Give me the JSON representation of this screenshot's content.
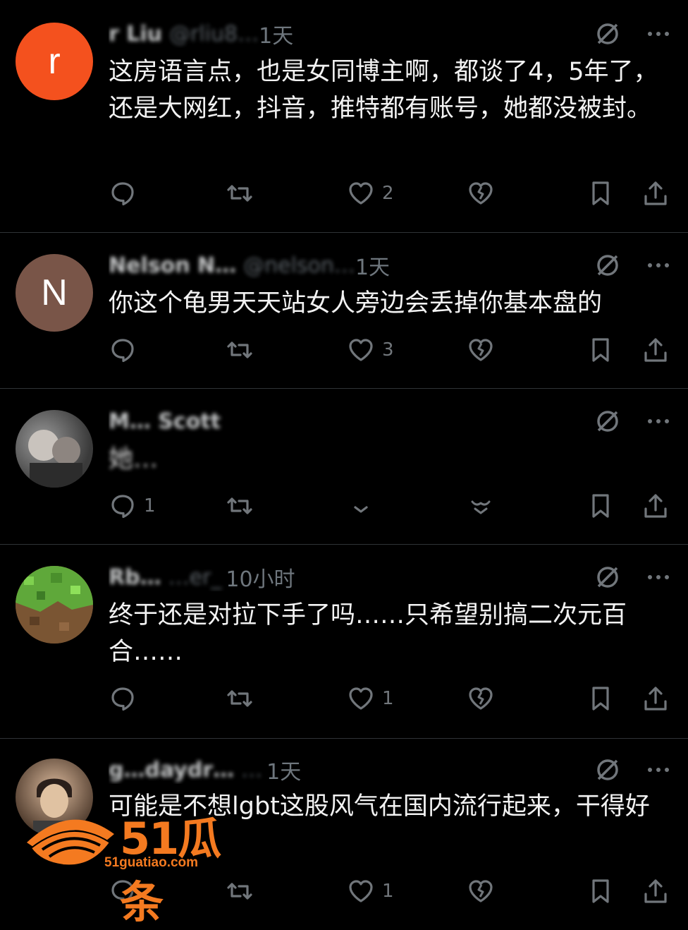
{
  "replies": [
    {
      "avatar_letter": "r",
      "avatar_color": "#f4511e",
      "name": "r Liu",
      "handle": "@rliu8…",
      "time": "1天",
      "text": "这房语言点，也是女同博主啊，都谈了4，5年了，还是大网红，抖音，推特都有账号，她都没被封。",
      "comments": "",
      "likes": "2"
    },
    {
      "avatar_letter": "N",
      "avatar_color": "#795548",
      "name": "Nelson N…",
      "handle": "@nelson…",
      "time": "1天",
      "text": "你这个龟男天天站女人旁边会丢掉你基本盘的",
      "comments": "",
      "likes": "3"
    },
    {
      "avatar_letter": "",
      "avatar_color": "#5a5a5a",
      "name": "M… Scott",
      "handle": "",
      "time": "",
      "text": "她…",
      "comments": "1",
      "likes": ""
    },
    {
      "avatar_letter": "",
      "avatar_color": "#4caf50",
      "name": "Rb…",
      "handle": "…er_",
      "time": "10小时",
      "text": "终于还是对拉下手了吗……只希望别搞二次元百合……",
      "comments": "",
      "likes": "1"
    },
    {
      "avatar_letter": "",
      "avatar_color": "#b08a6a",
      "name": "g…daydr…",
      "handle": "…",
      "time": "1天",
      "text": "可能是不想lgbt这股风气在国内流行起来，干得好",
      "comments": "",
      "likes": "1"
    }
  ],
  "watermark": {
    "brand": "51瓜条",
    "url": "51guatiao.com"
  },
  "icons": {
    "grok": "grok-slash-icon",
    "more": "more-dots-icon",
    "reply": "reply-bubble-icon",
    "retweet": "retweet-icon",
    "like": "heart-icon",
    "dislike": "broken-heart-icon",
    "bookmark": "bookmark-icon",
    "share": "share-icon"
  }
}
